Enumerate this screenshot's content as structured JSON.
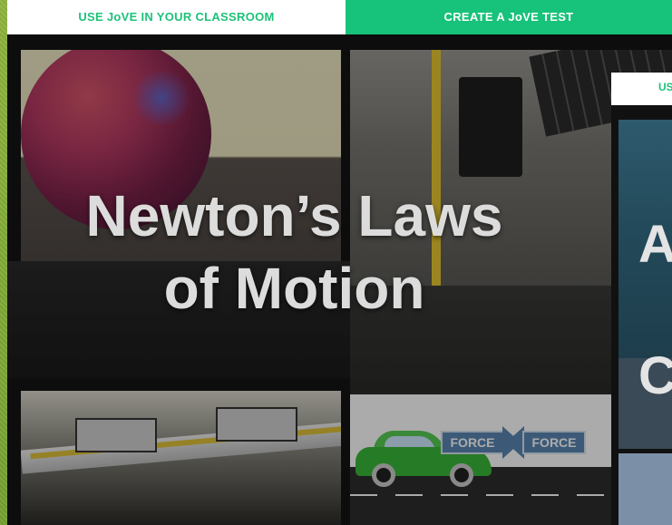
{
  "tabs": {
    "classroom_label": "USE JoVE IN YOUR CLASSROOM",
    "test_label": "CREATE A JoVE TEST"
  },
  "video_card": {
    "title_line1": "Newton’s Laws",
    "title_line2": "of Motion",
    "force_left": "FORCE",
    "force_right": "FORCE"
  },
  "next_card": {
    "header_partial": "US",
    "title_letter1": "A",
    "title_letter2": "C"
  }
}
